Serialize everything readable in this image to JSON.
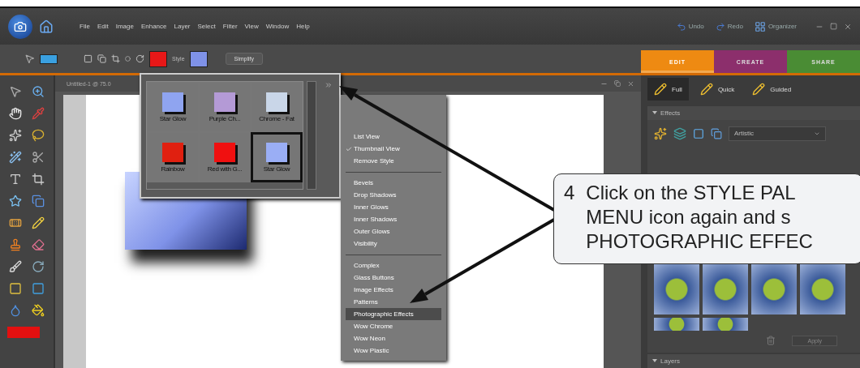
{
  "app_bar": {
    "menus": [
      "File",
      "Edit",
      "Image",
      "Enhance",
      "Layer",
      "Select",
      "Filter",
      "View",
      "Window",
      "Help"
    ],
    "actions": [
      {
        "kind": "undo",
        "label": "Undo"
      },
      {
        "kind": "redo",
        "label": "Redo"
      },
      {
        "kind": "organizer",
        "label": "Organizer"
      }
    ]
  },
  "options_bar": {
    "style_label": "Style",
    "simplify": "Simplify"
  },
  "mode_tabs": [
    {
      "label": "EDIT",
      "selected": true,
      "color": "#ee8a12"
    },
    {
      "label": "CREATE",
      "selected": false,
      "color": "#8c2f6c"
    },
    {
      "label": "SHARE",
      "selected": false,
      "color": "#4a8c34"
    }
  ],
  "document": {
    "title": "Untitled-1 @ 75.0"
  },
  "edit_modes": [
    {
      "label": "Full",
      "selected": true
    },
    {
      "label": "Quick",
      "selected": false
    },
    {
      "label": "Guided",
      "selected": false
    }
  ],
  "effects_panel": {
    "title": "Effects",
    "category": "Artistic",
    "apply": "Apply"
  },
  "layers_panel": {
    "title": "Layers"
  },
  "style_palette": {
    "styles": [
      {
        "name": "Star Glow",
        "selected": false,
        "color": "#8fa4f0"
      },
      {
        "name": "Purple Ch...",
        "selected": false,
        "color": "#b49ad6"
      },
      {
        "name": "Chrome - Fat",
        "selected": false,
        "color": "#c9d6e8"
      },
      {
        "name": "Rainbow",
        "selected": false,
        "color": "#e02010"
      },
      {
        "name": "Red with G...",
        "selected": false,
        "color": "#f01010"
      },
      {
        "name": "Star Glow",
        "selected": true,
        "color": "#9aaef5"
      }
    ]
  },
  "style_menu": {
    "items": [
      {
        "kind": "item",
        "label": "List View",
        "checked": false,
        "selected": false
      },
      {
        "kind": "item",
        "label": "Thumbnail View",
        "checked": true,
        "selected": false
      },
      {
        "kind": "item",
        "label": "Remove Style",
        "checked": false,
        "selected": false
      },
      {
        "kind": "separator"
      },
      {
        "kind": "item",
        "label": "Bevels",
        "checked": false,
        "selected": false
      },
      {
        "kind": "item",
        "label": "Drop Shadows",
        "checked": false,
        "selected": false
      },
      {
        "kind": "item",
        "label": "Inner Glows",
        "checked": false,
        "selected": false
      },
      {
        "kind": "item",
        "label": "Inner Shadows",
        "checked": false,
        "selected": false
      },
      {
        "kind": "item",
        "label": "Outer Glows",
        "checked": false,
        "selected": false
      },
      {
        "kind": "item",
        "label": "Visibility",
        "checked": false,
        "selected": false
      },
      {
        "kind": "separator"
      },
      {
        "kind": "item",
        "label": "Complex",
        "checked": false,
        "selected": false
      },
      {
        "kind": "item",
        "label": "Glass Buttons",
        "checked": false,
        "selected": false
      },
      {
        "kind": "item",
        "label": "Image Effects",
        "checked": false,
        "selected": false
      },
      {
        "kind": "item",
        "label": "Patterns",
        "checked": false,
        "selected": false
      },
      {
        "kind": "item",
        "label": "Photographic Effects",
        "checked": false,
        "selected": true
      },
      {
        "kind": "item",
        "label": "Wow Chrome",
        "checked": false,
        "selected": false
      },
      {
        "kind": "item",
        "label": "Wow Neon",
        "checked": false,
        "selected": false
      },
      {
        "kind": "item",
        "label": "Wow Plastic",
        "checked": false,
        "selected": false
      }
    ]
  },
  "callout": {
    "number": "4",
    "lines": [
      "Click on the STYLE PAL",
      "MENU icon again and s",
      "PHOTOGRAPHIC EFFEC"
    ]
  }
}
